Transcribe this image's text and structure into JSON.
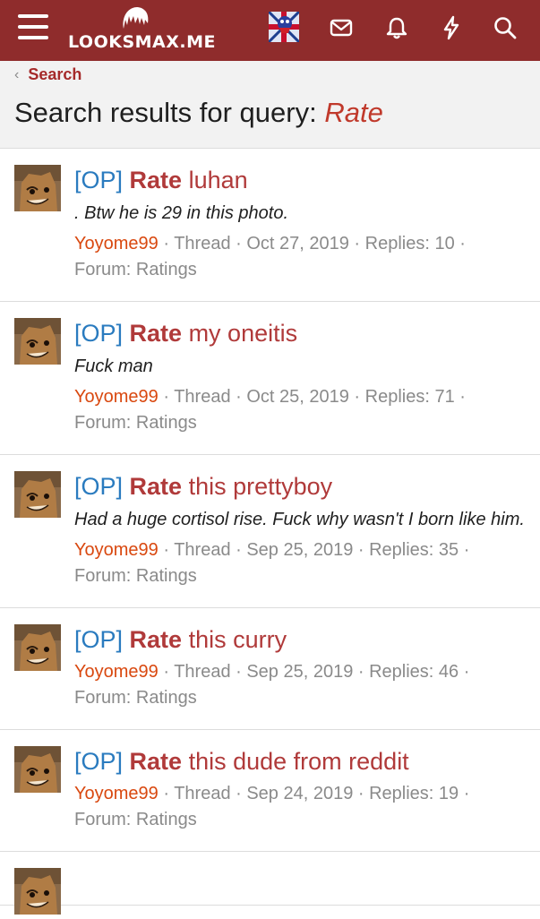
{
  "header": {
    "logo_text": "LOOKSMAX.ME",
    "icons": [
      "menu-icon",
      "envelope-icon",
      "bell-icon",
      "bolt-icon",
      "search-icon"
    ]
  },
  "breadcrumb": {
    "label": "Search"
  },
  "page": {
    "title_prefix": "Search results for query: ",
    "query": "Rate"
  },
  "colors": {
    "header_bg": "#8f2c2c",
    "accent": "#b03a3a",
    "op_prefix": "#2a7bbf",
    "username": "#d9480f",
    "muted": "#8a8a8a"
  },
  "results": [
    {
      "prefix": "[OP]",
      "highlight": "Rate",
      "rest": " luhan",
      "snippet": ". Btw he is 29 in this photo.",
      "user": "Yoyome99",
      "meta": " · Thread · Oct 27, 2019 · Replies: 10 ·",
      "forum": "Forum: Ratings"
    },
    {
      "prefix": "[OP]",
      "highlight": "Rate",
      "rest": " my oneitis",
      "snippet": "Fuck man",
      "user": "Yoyome99",
      "meta": " · Thread · Oct 25, 2019 · Replies: 71 ·",
      "forum": "Forum: Ratings"
    },
    {
      "prefix": "[OP]",
      "highlight": "Rate",
      "rest": " this prettyboy",
      "snippet": "Had a huge cortisol rise. Fuck why wasn't I born like him.",
      "user": "Yoyome99",
      "meta": " · Thread · Sep 25, 2019 · Replies: 35 ·",
      "forum": "Forum: Ratings"
    },
    {
      "prefix": "[OP]",
      "highlight": "Rate",
      "rest": " this curry",
      "snippet": "",
      "user": "Yoyome99",
      "meta": " · Thread · Sep 25, 2019 · Replies: 46 ·",
      "forum": "Forum: Ratings"
    },
    {
      "prefix": "[OP]",
      "highlight": "Rate",
      "rest": " this dude from reddit",
      "snippet": "",
      "user": "Yoyome99",
      "meta": " · Thread · Sep 24, 2019 · Replies: 19 ·",
      "forum": "Forum: Ratings"
    }
  ]
}
